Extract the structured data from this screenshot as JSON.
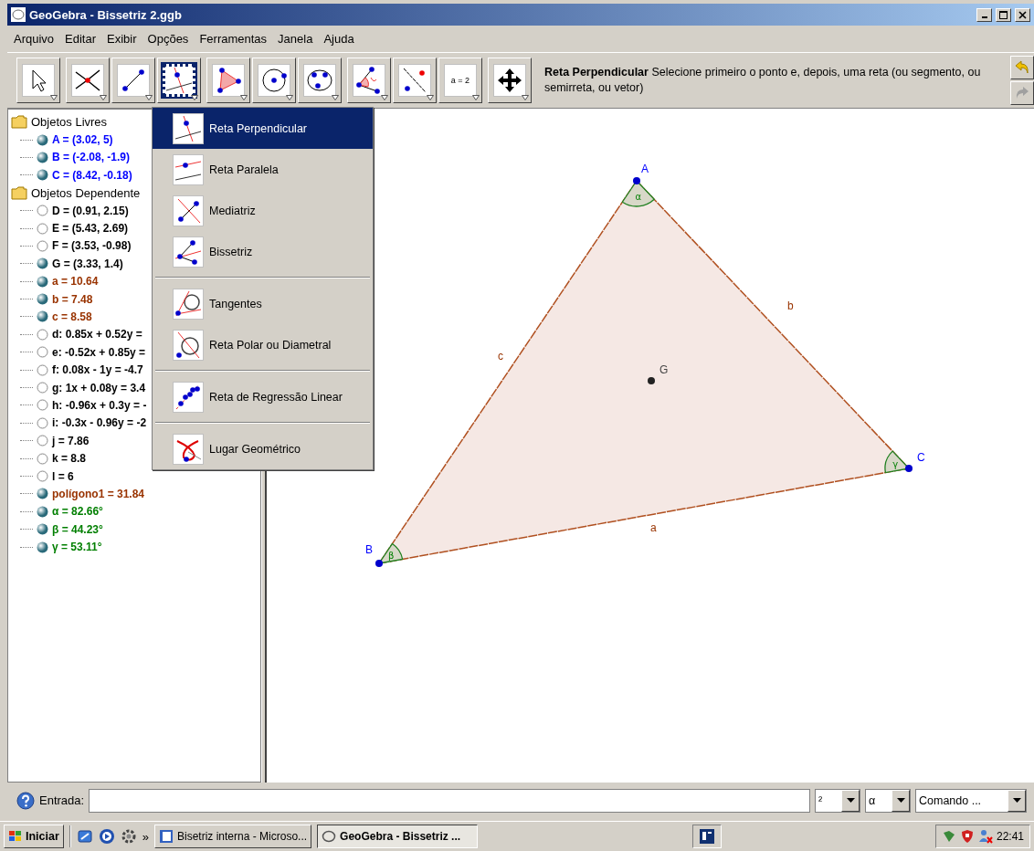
{
  "window": {
    "title": "GeoGebra - Bissetriz 2.ggb"
  },
  "menu": [
    "Arquivo",
    "Editar",
    "Exibir",
    "Opções",
    "Ferramentas",
    "Janela",
    "Ajuda"
  ],
  "toolbar": {
    "groups": [
      [
        {
          "kind": "pointer",
          "selected": false
        }
      ],
      [
        {
          "kind": "intersect",
          "selected": false
        },
        {
          "kind": "segment",
          "selected": false
        },
        {
          "kind": "perpendicular",
          "selected": true
        }
      ],
      [
        {
          "kind": "polygon",
          "selected": false
        },
        {
          "kind": "circle",
          "selected": false
        },
        {
          "kind": "conic",
          "selected": false
        }
      ],
      [
        {
          "kind": "angle",
          "selected": false
        },
        {
          "kind": "reflect",
          "selected": false
        },
        {
          "kind": "slider",
          "selected": false,
          "label": "a = 2"
        }
      ],
      [
        {
          "kind": "move",
          "selected": false
        }
      ]
    ]
  },
  "tool_help": "**Reta Perpendicular**  Selecione primeiro o ponto e, depois, uma reta (ou segmento, ou semirreta, ou vetor)",
  "algebra": {
    "folders": [
      {
        "name": "Objetos Livres",
        "children": [
          {
            "text": "A = (3.02, 5)",
            "color": "#0000ff",
            "visible": true
          },
          {
            "text": "B = (-2.08, -1.9)",
            "color": "#0000ff",
            "visible": true
          },
          {
            "text": "C = (8.42, -0.18)",
            "color": "#0000ff",
            "visible": true
          }
        ]
      },
      {
        "name": "Objetos Dependente",
        "children": [
          {
            "text": "D = (0.91, 2.15)",
            "color": "#000000",
            "visible": false
          },
          {
            "text": "E = (5.43, 2.69)",
            "color": "#000000",
            "visible": false
          },
          {
            "text": "F = (3.53, -0.98)",
            "color": "#000000",
            "visible": false
          },
          {
            "text": "G = (3.33, 1.4)",
            "color": "#000000",
            "visible": true
          },
          {
            "text": "a = 10.64",
            "color": "#993300",
            "visible": true
          },
          {
            "text": "b = 7.48",
            "color": "#993300",
            "visible": true
          },
          {
            "text": "c = 8.58",
            "color": "#993300",
            "visible": true
          },
          {
            "text": "d: 0.85x + 0.52y =",
            "color": "#000000",
            "visible": false
          },
          {
            "text": "e: -0.52x + 0.85y =",
            "color": "#000000",
            "visible": false
          },
          {
            "text": "f: 0.08x - 1y = -4.7",
            "color": "#000000",
            "visible": false
          },
          {
            "text": "g: 1x + 0.08y = 3.4",
            "color": "#000000",
            "visible": false
          },
          {
            "text": "h: -0.96x + 0.3y = -",
            "color": "#000000",
            "visible": false
          },
          {
            "text": "i: -0.3x - 0.96y = -2",
            "color": "#000000",
            "visible": false
          },
          {
            "text": "j = 7.86",
            "color": "#000000",
            "visible": false
          },
          {
            "text": "k = 8.8",
            "color": "#000000",
            "visible": false
          },
          {
            "text": "l = 6",
            "color": "#000000",
            "visible": false
          },
          {
            "text": "polígono1 = 31.84",
            "color": "#993300",
            "visible": true
          },
          {
            "text": "α = 82.66°",
            "color": "#007f00",
            "visible": true
          },
          {
            "text": "β = 44.23°",
            "color": "#007f00",
            "visible": true
          },
          {
            "text": "γ = 53.11°",
            "color": "#007f00",
            "visible": true
          }
        ]
      }
    ]
  },
  "tool_menu": {
    "groups": [
      [
        {
          "label": "Reta Perpendicular",
          "kind": "perpendicular",
          "selected": true
        },
        {
          "label": "Reta Paralela",
          "kind": "parallel",
          "selected": false
        },
        {
          "label": "Mediatriz",
          "kind": "bisector",
          "selected": false
        },
        {
          "label": "Bissetriz",
          "kind": "anglebisector",
          "selected": false
        }
      ],
      [
        {
          "label": "Tangentes",
          "kind": "tangent",
          "selected": false
        },
        {
          "label": "Reta Polar ou Diametral",
          "kind": "polar",
          "selected": false
        }
      ],
      [
        {
          "label": "Reta de Regressão Linear",
          "kind": "regression",
          "selected": false
        }
      ],
      [
        {
          "label": "Lugar Geométrico",
          "kind": "locus",
          "selected": false
        }
      ]
    ]
  },
  "graphics": {
    "points": [
      "A",
      "B",
      "C",
      "G"
    ],
    "segments": [
      "a",
      "b",
      "c"
    ],
    "angles": [
      "α",
      "β",
      "γ"
    ]
  },
  "input_bar": {
    "label": "Entrada:",
    "symbols": [
      "²",
      "α"
    ],
    "command": "Comando ..."
  },
  "taskbar": {
    "start": "Iniciar",
    "more": "»",
    "tasks": [
      {
        "label": "Bisetriz interna - Microso...",
        "selected": false
      },
      {
        "label": "GeoGebra - Bissetriz ...",
        "selected": true
      }
    ],
    "clock": "22:41"
  }
}
